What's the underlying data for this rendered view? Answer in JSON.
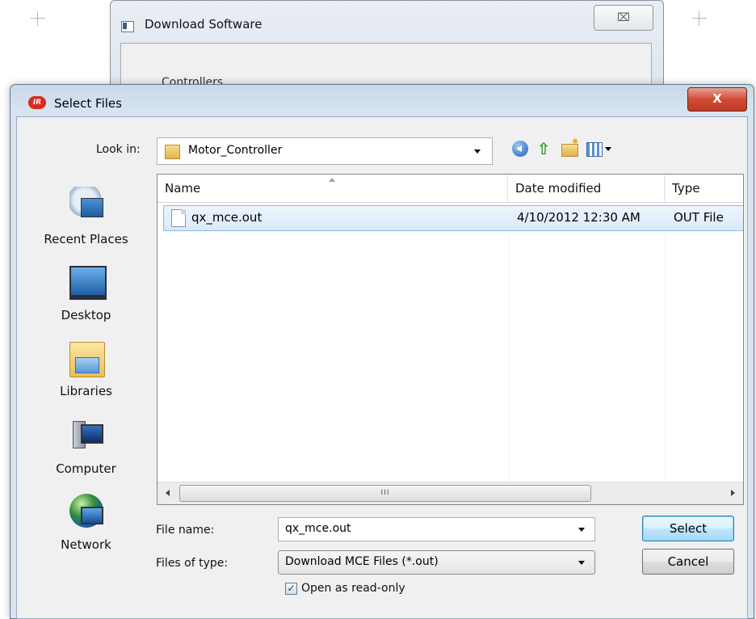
{
  "background_window": {
    "title": "Download Software",
    "close_glyph": "⌧",
    "group_label": "Controllers"
  },
  "dialog": {
    "title": "Select Files",
    "app_icon_text": "IR",
    "close_glyph": "X",
    "look_in": {
      "label": "Look in:",
      "value": "Motor_Controller"
    },
    "toolbar": [
      "back-icon",
      "up-folder-icon",
      "new-folder-icon",
      "view-menu-icon"
    ],
    "places": [
      {
        "label": "Recent Places",
        "icon": "recent-places-icon"
      },
      {
        "label": "Desktop",
        "icon": "desktop-icon"
      },
      {
        "label": "Libraries",
        "icon": "libraries-icon"
      },
      {
        "label": "Computer",
        "icon": "computer-icon"
      },
      {
        "label": "Network",
        "icon": "network-icon"
      }
    ],
    "file_list": {
      "columns": [
        "Name",
        "Date modified",
        "Type"
      ],
      "rows": [
        {
          "name": "qx_mce.out",
          "date": "4/10/2012 12:30 AM",
          "type": "OUT File",
          "selected": true
        }
      ],
      "scroll_thumb_text": "III"
    },
    "file_name": {
      "label": "File name:",
      "value": "qx_mce.out"
    },
    "files_of_type": {
      "label": "Files of type:",
      "value": "Download MCE Files (*.out)"
    },
    "read_only": {
      "label": "Open as read-only",
      "checked": true,
      "check_glyph": "✓"
    },
    "buttons": {
      "select": "Select",
      "cancel": "Cancel"
    }
  }
}
